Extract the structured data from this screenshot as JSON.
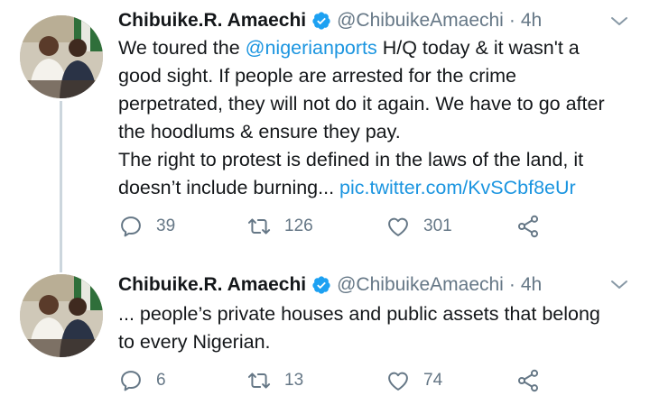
{
  "tweets": [
    {
      "author_name": "Chibuike.R. Amaechi",
      "handle": "@ChibuikeAmaechi",
      "separator": "·",
      "time": "4h",
      "text_lines": [
        {
          "before": "We toured the ",
          "link": "@nigerianports",
          "after": " H/Q today & it wasn't a"
        },
        {
          "before": "good sight. If people are arrested for the crime",
          "link": "",
          "after": ""
        },
        {
          "before": "perpetrated, they will not do it again. We have to go after",
          "link": "",
          "after": ""
        },
        {
          "before": "the hoodlums & ensure they pay.",
          "link": "",
          "after": ""
        },
        {
          "before": "The right to protest is defined in the laws of the land, it",
          "link": "",
          "after": ""
        },
        {
          "before": "doesn’t include burning... ",
          "link": "pic.twitter.com/KvSCbf8eUr",
          "after": ""
        }
      ],
      "replies": "39",
      "retweets": "126",
      "likes": "301"
    },
    {
      "author_name": "Chibuike.R. Amaechi",
      "handle": "@ChibuikeAmaechi",
      "separator": "·",
      "time": "4h",
      "text_lines": [
        {
          "before": "... people’s private houses and public assets that belong",
          "link": "",
          "after": ""
        },
        {
          "before": "to every Nigerian.",
          "link": "",
          "after": ""
        }
      ],
      "replies": "6",
      "retweets": "13",
      "likes": "74"
    }
  ],
  "colors": {
    "text": "#14171a",
    "secondary": "#657786",
    "link": "#1b95e0",
    "verified": "#1da1f2",
    "thread_line": "#ccd6dd"
  },
  "icons": [
    "reply-icon",
    "retweet-icon",
    "like-icon",
    "share-icon",
    "verified-badge-icon",
    "caret-down-icon"
  ]
}
